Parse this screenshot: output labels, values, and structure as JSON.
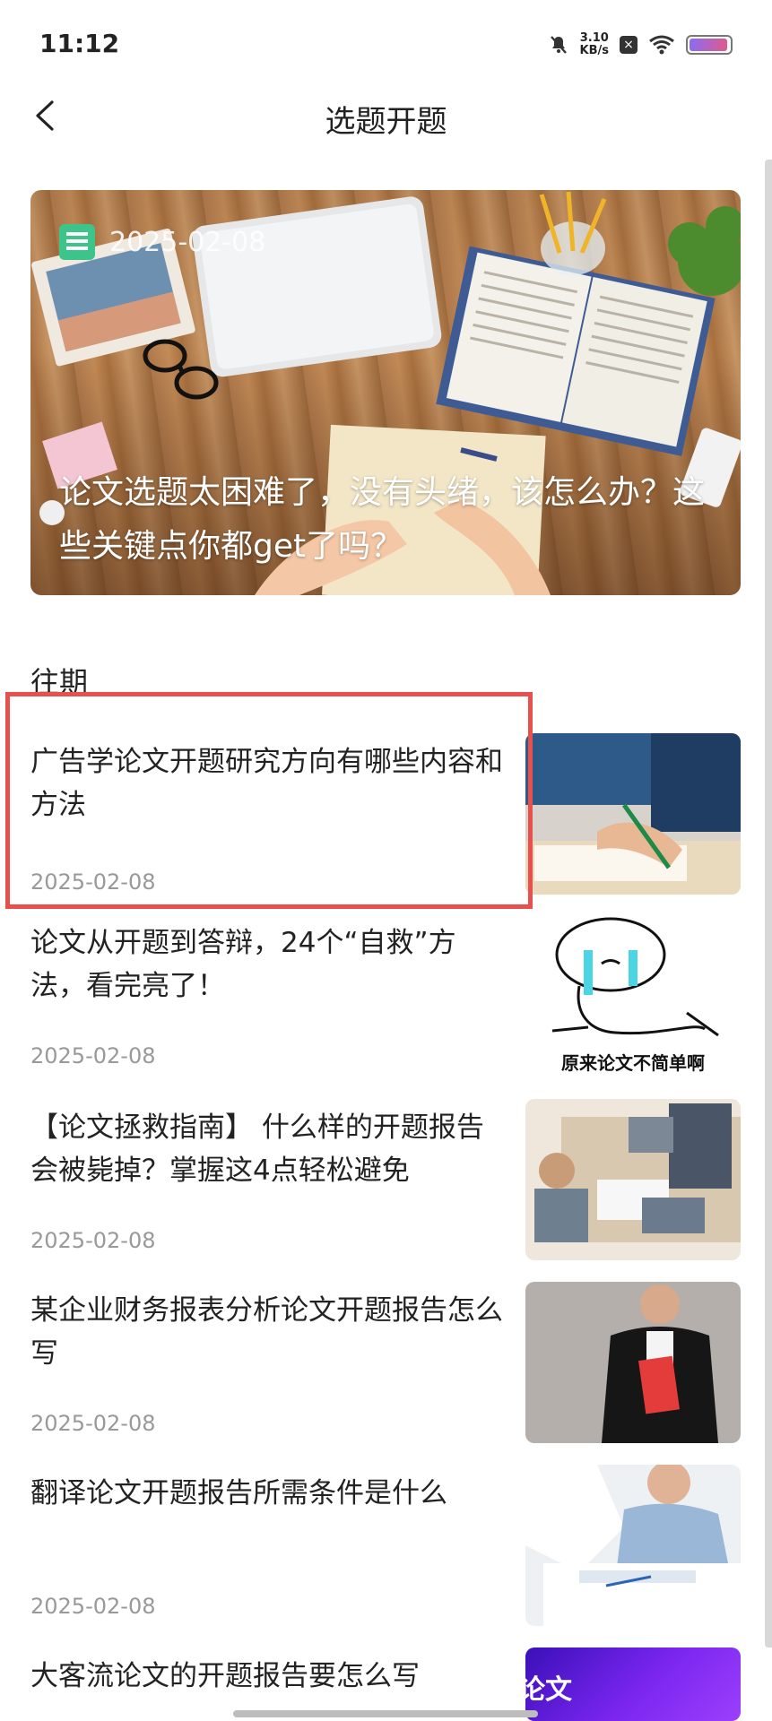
{
  "status_bar": {
    "time": "11:12",
    "net_speed_value": "3.10",
    "net_speed_unit": "KB/s",
    "battery_level": 0.95
  },
  "header": {
    "title": "选题开题",
    "back_icon": "chevron-left-icon"
  },
  "hero": {
    "date": "2025-02-08",
    "title": "论文选题太困难了，没有头绪，该怎么办？这些关键点你都get了吗？",
    "icon": "news-icon"
  },
  "past": {
    "label": "往期",
    "articles": [
      {
        "title": "广告学论文开题研究方向有哪些内容和方法",
        "date": "2025-02-08"
      },
      {
        "title": "论文从开题到答辩，24个“自救”方法，看完亮了！",
        "date": "2025-02-08",
        "thumb_caption": "原来论文不简单啊"
      },
      {
        "title": "【论文拯救指南】 什么样的开题报告会被毙掉？掌握这4点轻松避免",
        "date": "2025-02-08"
      },
      {
        "title": "某企业财务报表分析论文开题报告怎么写",
        "date": "2025-02-08"
      },
      {
        "title": "翻译论文开题报告所需条件是什么",
        "date": "2025-02-08"
      },
      {
        "title": "大客流论文的开题报告要怎么写",
        "date": "",
        "thumb_caption": "论文"
      }
    ]
  },
  "colors": {
    "highlight": "#e8504e",
    "date_text": "#999999",
    "news_icon": "#3cc48a"
  }
}
